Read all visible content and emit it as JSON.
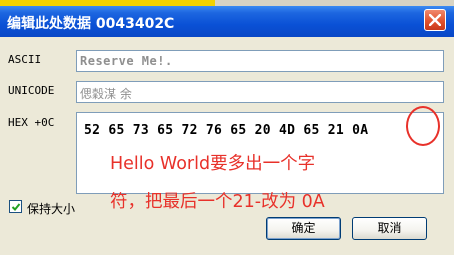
{
  "window": {
    "title": "编辑此处数据 0043402C"
  },
  "fields": {
    "ascii": {
      "label": "ASCII",
      "value": "Reserve Me!."
    },
    "unicode": {
      "label": "UNICODE",
      "value": "偲穀湈 余"
    },
    "hex": {
      "label": "HEX +0C",
      "value": "52 65 73 65 72 76 65 20 4D 65 21 0A"
    }
  },
  "annotation": {
    "line1": "Hello World要多出一个字",
    "line2": "符，把最后一个21-改为 0A",
    "color": "#e8312a"
  },
  "options": {
    "keep_size_label": "保持大小",
    "keep_size_checked": true
  },
  "buttons": {
    "ok": "确定",
    "cancel": "取消"
  },
  "colors": {
    "titlebar": "#0a51d6",
    "dialog_bg": "#ece9d8"
  }
}
